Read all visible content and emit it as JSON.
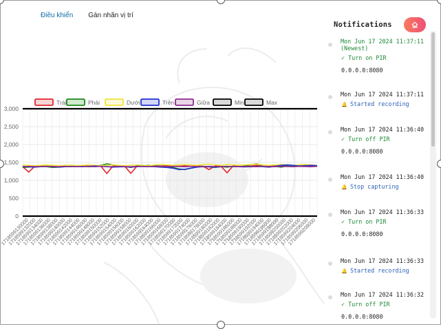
{
  "tabs": [
    {
      "label": "Điều khiển",
      "active": true
    },
    {
      "label": "Gán nhãn vị trí",
      "active": false
    }
  ],
  "chart_data": {
    "type": "line",
    "ylim": [
      0,
      3000
    ],
    "yticks": [
      "3,000",
      "2,500",
      "2,000",
      "1,500",
      "1,000",
      "500",
      "0"
    ],
    "x": [
      "1718599130000",
      "1718599132000",
      "1718599134000",
      "1718599136000",
      "1718599138000",
      "1718599140000",
      "1718599142000",
      "1718599144000",
      "1718599146000",
      "1718599148000",
      "1718599150000",
      "1718599152000",
      "1718599154000",
      "1718599156000",
      "1718599158000",
      "1718599160000",
      "1718599162000",
      "1718599164000",
      "1718599166000",
      "1718599168000",
      "1718599170000",
      "1718599172000",
      "1718599174000",
      "1718599176000",
      "1718599178000",
      "1718599180000",
      "1718599182000",
      "1718599184000",
      "1718599186000",
      "1718599188000",
      "1718599190000",
      "1718599192000",
      "1718599194000",
      "1718599196000",
      "1718599198000",
      "1718599200000",
      "1718599202000",
      "1718599204000",
      "1718599206000",
      "1718599208000"
    ],
    "legend_position": "top",
    "series": [
      {
        "name": "Trái",
        "color": "#e0262b",
        "values": [
          1380,
          1230,
          1390,
          1400,
          1390,
          1395,
          1400,
          1390,
          1380,
          1400,
          1410,
          1395,
          1400,
          1395,
          1190,
          1400,
          1395,
          1390,
          1195,
          1395,
          1400,
          1390,
          1410,
          1400,
          1410,
          1400,
          1395,
          1405,
          1390,
          1400,
          1395,
          1300,
          1400,
          1395,
          1210,
          1400,
          1390,
          1385,
          1400,
          1420,
          1395,
          1390,
          1400,
          1410,
          1400,
          1380,
          1420,
          1395,
          1390,
          1400
        ]
      },
      {
        "name": "Phải",
        "color": "#1a8a1a",
        "values": [
          1360,
          1370,
          1380,
          1390,
          1380,
          1360,
          1370,
          1380,
          1385,
          1390,
          1400,
          1380,
          1390,
          1420,
          1460,
          1430,
          1380,
          1390,
          1360,
          1400,
          1410,
          1420,
          1400,
          1390,
          1380,
          1360,
          1320,
          1300,
          1340,
          1380,
          1390,
          1380,
          1360,
          1380,
          1370,
          1390,
          1380,
          1400,
          1440,
          1460,
          1390,
          1380,
          1390,
          1370,
          1400,
          1410,
          1430,
          1440,
          1420,
          1400
        ]
      },
      {
        "name": "Dưới",
        "color": "#f0e23a",
        "values": [
          1430,
          1420,
          1410,
          1420,
          1430,
          1420,
          1410,
          1420,
          1430,
          1410,
          1420,
          1430,
          1420,
          1410,
          1420,
          1430,
          1420,
          1410,
          1420,
          1430,
          1420,
          1410,
          1430,
          1440,
          1430,
          1420,
          1430,
          1440,
          1430,
          1420,
          1440,
          1450,
          1430,
          1420,
          1440,
          1430,
          1420,
          1430,
          1440,
          1450,
          1430,
          1420,
          1430,
          1440,
          1430,
          1420,
          1430,
          1440,
          1430,
          1420
        ]
      },
      {
        "name": "Trên",
        "color": "#2130d6",
        "values": [
          1390,
          1380,
          1370,
          1380,
          1390,
          1380,
          1370,
          1380,
          1390,
          1385,
          1380,
          1390,
          1400,
          1390,
          1380,
          1370,
          1375,
          1380,
          1370,
          1380,
          1390,
          1385,
          1380,
          1370,
          1360,
          1340,
          1300,
          1310,
          1340,
          1370,
          1380,
          1375,
          1370,
          1380,
          1390,
          1385,
          1380,
          1375,
          1380,
          1390,
          1380,
          1370,
          1390,
          1420,
          1430,
          1420,
          1400,
          1410,
          1420,
          1410
        ]
      },
      {
        "name": "Giữa",
        "color": "#8e2b8e",
        "values": [
          1380,
          1390,
          1385,
          1380,
          1390,
          1385,
          1380,
          1390,
          1385,
          1380,
          1390,
          1385,
          1380,
          1390,
          1385,
          1380,
          1390,
          1385,
          1380,
          1390,
          1385,
          1380,
          1390,
          1385,
          1380,
          1390,
          1385,
          1380,
          1390,
          1385,
          1380,
          1390,
          1385,
          1380,
          1390,
          1385,
          1380,
          1390,
          1385,
          1380,
          1390,
          1385,
          1380,
          1390,
          1385,
          1380,
          1390,
          1385,
          1380,
          1390
        ]
      },
      {
        "name": "Min",
        "color": "#000000",
        "values": [
          0,
          0,
          0,
          0,
          0,
          0,
          0,
          0,
          0,
          0,
          0,
          0,
          0,
          0,
          0,
          0,
          0,
          0,
          0,
          0,
          0,
          0,
          0,
          0,
          0,
          0,
          0,
          0,
          0,
          0,
          0,
          0,
          0,
          0,
          0,
          0,
          0,
          0,
          0,
          0,
          0,
          0,
          0,
          0,
          0,
          0,
          0,
          0,
          0,
          0
        ]
      },
      {
        "name": "Max",
        "color": "#000000",
        "values": [
          3000,
          3000,
          3000,
          3000,
          3000,
          3000,
          3000,
          3000,
          3000,
          3000,
          3000,
          3000,
          3000,
          3000,
          3000,
          3000,
          3000,
          3000,
          3000,
          3000,
          3000,
          3000,
          3000,
          3000,
          3000,
          3000,
          3000,
          3000,
          3000,
          3000,
          3000,
          3000,
          3000,
          3000,
          3000,
          3000,
          3000,
          3000,
          3000,
          3000,
          3000,
          3000,
          3000,
          3000,
          3000,
          3000,
          3000,
          3000,
          3000,
          3000
        ]
      }
    ]
  },
  "notifications": {
    "title": "Notifications",
    "home_icon": "home-icon",
    "items": [
      {
        "timestamp": "Mon Jun 17 2024 11:37:11\n(Newest)",
        "newest": true,
        "icon": "check",
        "action": "Turn on PIR",
        "address": "0.0.0.0:8080"
      },
      {
        "timestamp": "Mon Jun 17 2024 11:37:11",
        "newest": false,
        "icon": "bell",
        "action": "Started recording",
        "address": ""
      },
      {
        "timestamp": "Mon Jun 17 2024 11:36:40",
        "newest": false,
        "icon": "check",
        "action": "Turn off PIR",
        "address": "0.0.0.0:8080"
      },
      {
        "timestamp": "Mon Jun 17 2024 11:36:40",
        "newest": false,
        "icon": "bell",
        "action": "Stop capturing",
        "address": ""
      },
      {
        "timestamp": "Mon Jun 17 2024 11:36:33",
        "newest": false,
        "icon": "check",
        "action": "Turn on PIR",
        "address": "0.0.0.0:8080"
      },
      {
        "timestamp": "Mon Jun 17 2024 11:36:33",
        "newest": false,
        "icon": "bell",
        "action": "Started recording",
        "address": ""
      },
      {
        "timestamp": "Mon Jun 17 2024 11:36:32",
        "newest": false,
        "icon": "check",
        "action": "Turn off PIR",
        "address": "0.0.0.0:8080"
      }
    ]
  }
}
